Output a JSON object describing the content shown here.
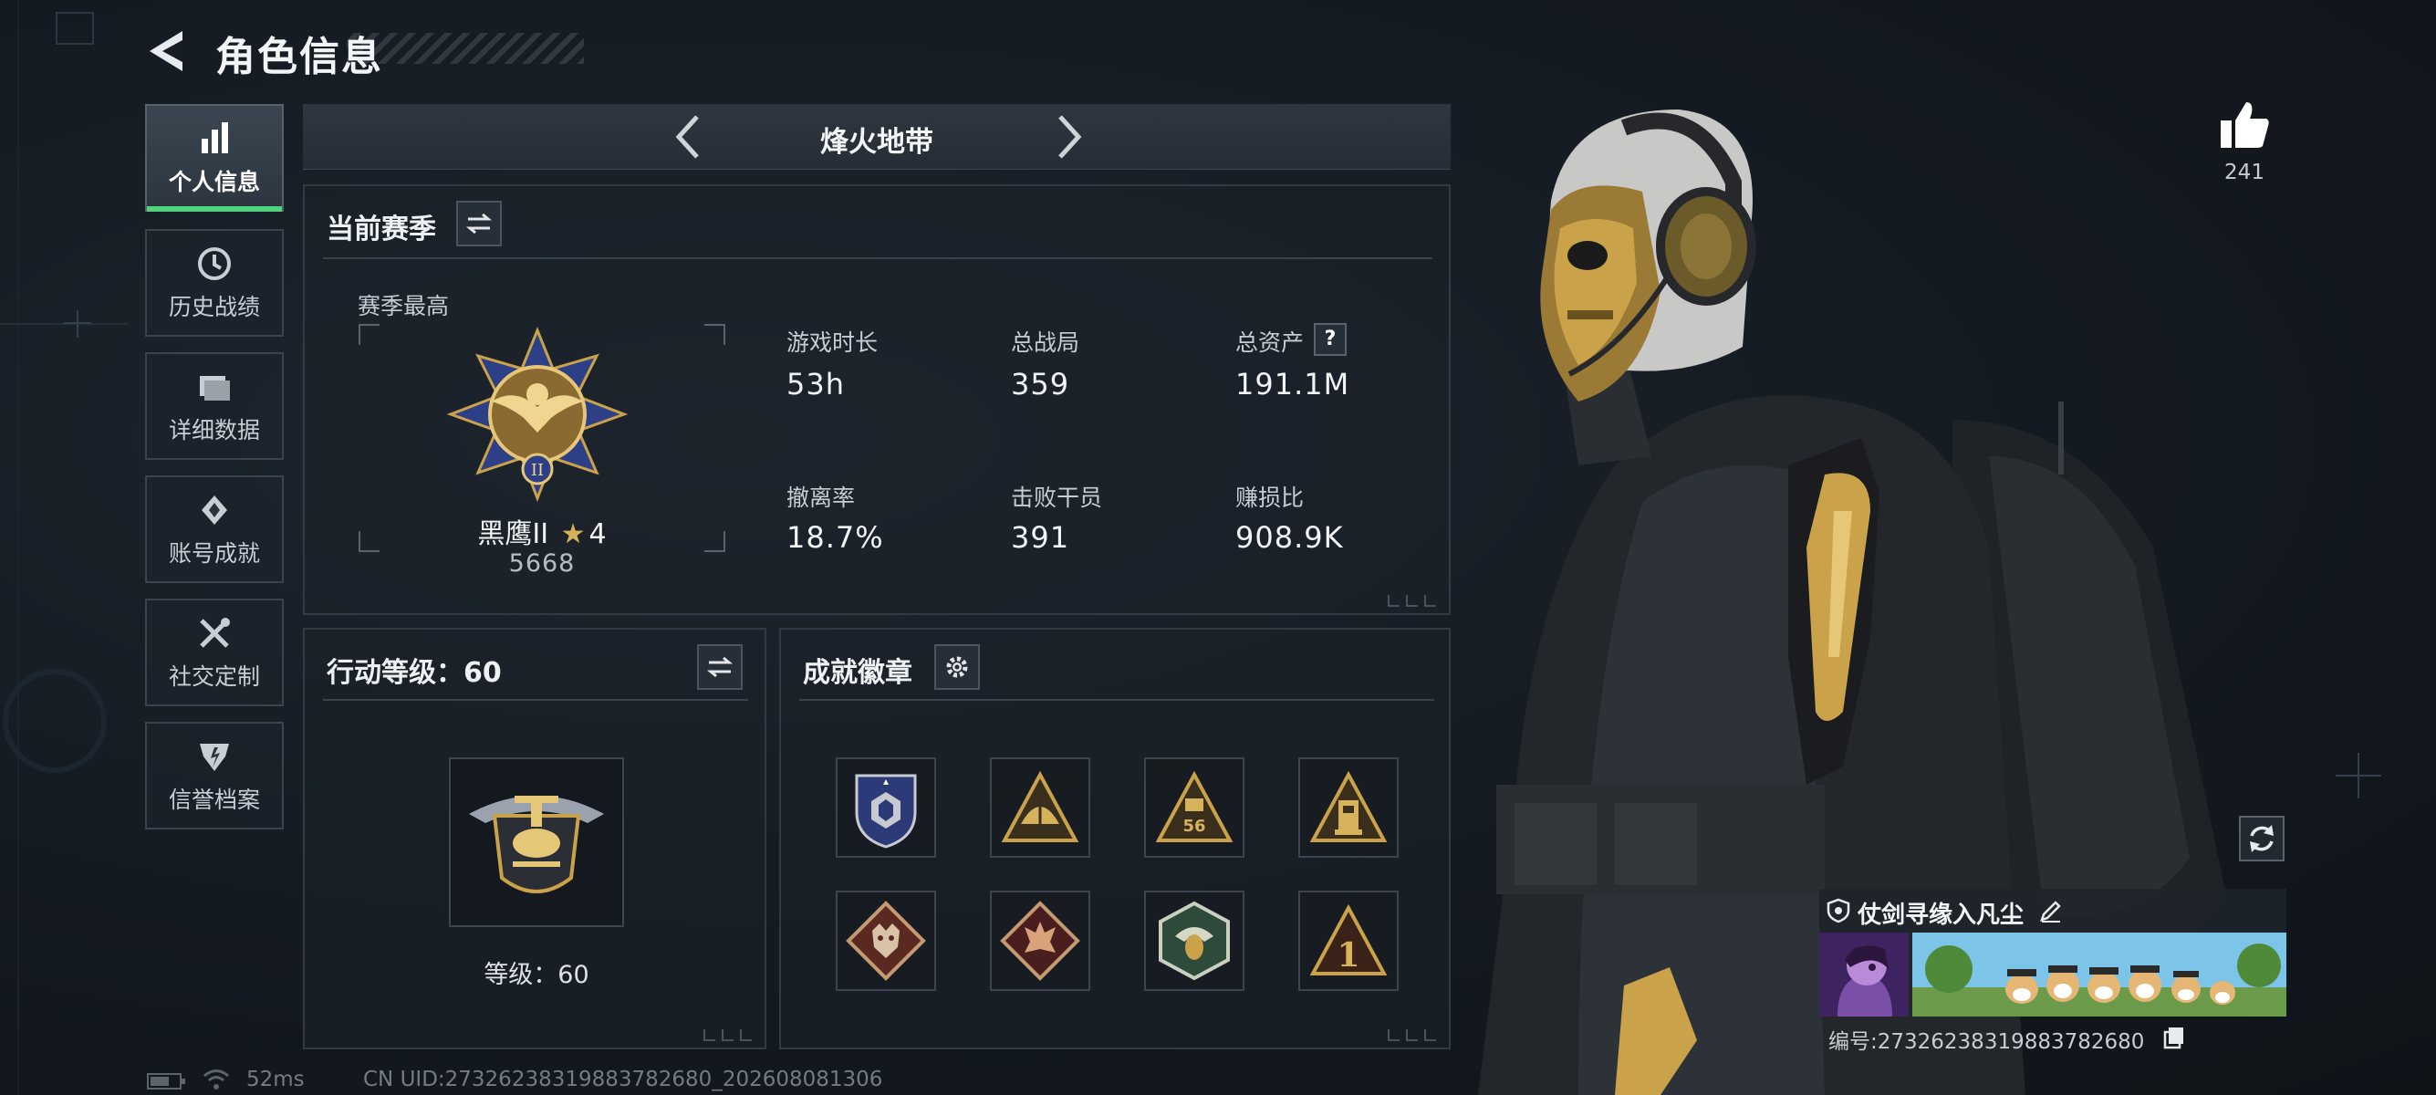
{
  "header": {
    "title": "角色信息"
  },
  "sidebar": {
    "items": [
      {
        "label": "个人信息",
        "icon": "bar-chart-icon",
        "active": true
      },
      {
        "label": "历史战绩",
        "icon": "history-clock-icon",
        "active": false
      },
      {
        "label": "详细数据",
        "icon": "folder-icon",
        "active": false
      },
      {
        "label": "账号成就",
        "icon": "achievement-diamond-icon",
        "active": false
      },
      {
        "label": "社交定制",
        "icon": "wrench-tools-icon",
        "active": false
      },
      {
        "label": "信誉档案",
        "icon": "reputation-shield-icon",
        "active": false
      }
    ]
  },
  "mode": {
    "title": "烽火地带"
  },
  "season": {
    "title": "当前赛季",
    "best_label": "赛季最高",
    "rank_name": "黑鹰II",
    "rank_stars": "4",
    "rank_points": "5668",
    "stats": [
      {
        "label": "游戏时长",
        "value": "53h"
      },
      {
        "label": "总战局",
        "value": "359"
      },
      {
        "label": "总资产",
        "value": "191.1M",
        "help": "?"
      },
      {
        "label": "撤离率",
        "value": "18.7%"
      },
      {
        "label": "击败干员",
        "value": "391"
      },
      {
        "label": "赚损比",
        "value": "908.9K"
      }
    ]
  },
  "action_level": {
    "title": "行动等级：60",
    "level_text": "等级：60"
  },
  "achievements": {
    "title": "成就徽章",
    "badges": [
      {
        "icon": "blue-shield-badge-icon"
      },
      {
        "icon": "gold-triangle-badge-icon"
      },
      {
        "icon": "triangle-56-badge-icon"
      },
      {
        "icon": "triangle-tower-badge-icon"
      },
      {
        "icon": "wolf-diamond-badge-icon"
      },
      {
        "icon": "dragon-diamond-badge-icon"
      },
      {
        "icon": "green-hexagon-badge-icon"
      },
      {
        "icon": "triangle-1-badge-icon"
      }
    ]
  },
  "likes": {
    "count": "241"
  },
  "player": {
    "name": "仗剑寻缘入凡尘",
    "id_text": "编号:27326238319883782680"
  },
  "status_bar": {
    "ping": "52ms",
    "uid": "CN UID:27326238319883782680_202608081306"
  },
  "colors": {
    "accent_green": "#4fd37c",
    "panel_border": "#323a44",
    "gold": "#c9a24a"
  }
}
